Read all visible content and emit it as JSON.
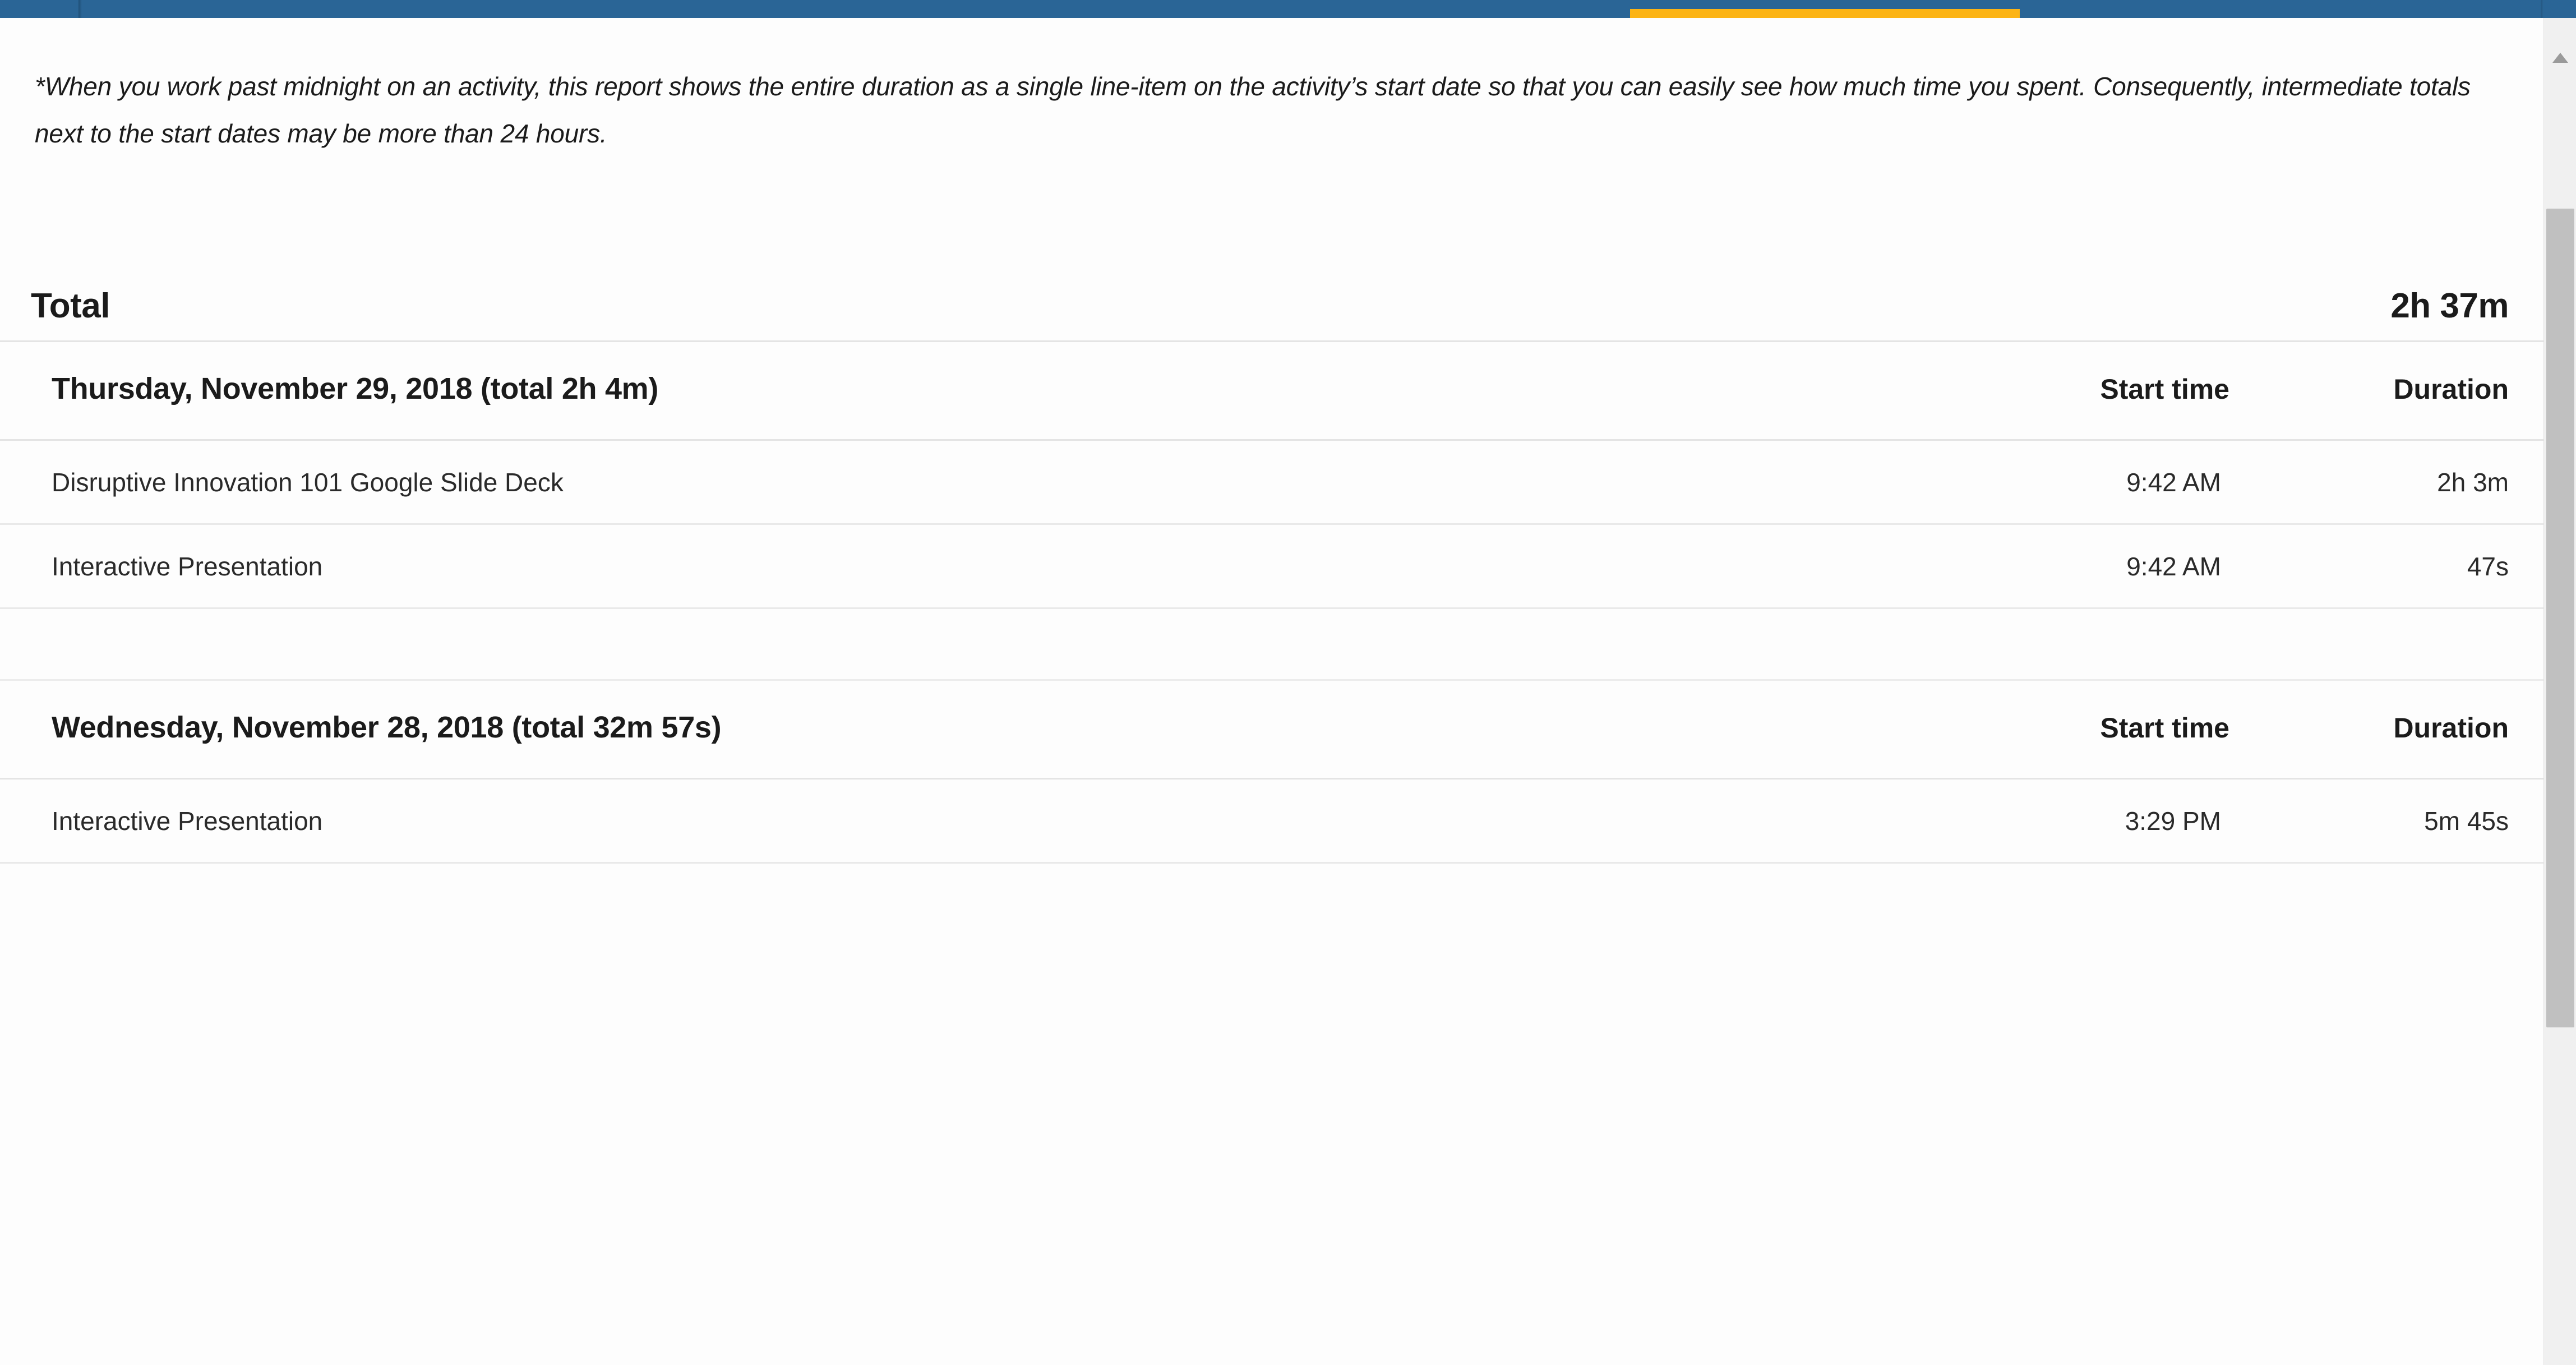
{
  "navbar": {
    "background_color": "#2a6596",
    "active_tab_color": "#fcb415",
    "active_tab_name": "active-tab-indicator"
  },
  "footnote": {
    "text": "*When you work past midnight on an activity, this report shows the entire duration as a single line-item on the activity’s start date so that you can easily see how much time you spent. Consequently, intermediate totals next to the start dates may be more than 24 hours."
  },
  "total": {
    "label": "Total",
    "value": "2h 37m"
  },
  "columns": {
    "start_time": "Start time",
    "duration": "Duration"
  },
  "days": [
    {
      "title": "Thursday, November 29, 2018 (total 2h 4m)",
      "rows": [
        {
          "name": "Disruptive Innovation 101 Google Slide Deck",
          "start": "9:42 AM",
          "duration": "2h 3m"
        },
        {
          "name": "Interactive Presentation",
          "start": "9:42 AM",
          "duration": "47s"
        }
      ]
    },
    {
      "title": "Wednesday, November 28, 2018 (total 32m 57s)",
      "rows": [
        {
          "name": "Interactive Presentation",
          "start": "3:29 PM",
          "duration": "5m 45s"
        }
      ]
    }
  ],
  "scrollbar": {
    "up_arrow_icon": "chevron-up-icon",
    "thumb_name": "scroll-thumb"
  }
}
